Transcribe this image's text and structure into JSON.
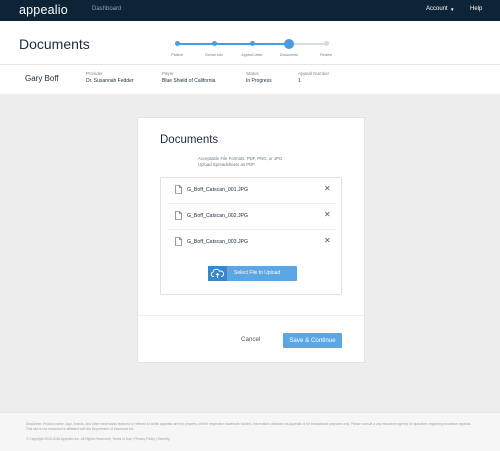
{
  "app": {
    "logo": "appealio",
    "nav_dashboard": "Dashboard",
    "nav_account": "Account",
    "nav_help": "Help"
  },
  "page": {
    "title": "Documents"
  },
  "stepper": {
    "accent": "#4a9be0",
    "inactive": "#d6dbe0",
    "steps": [
      {
        "label": "Patient",
        "state": "complete"
      },
      {
        "label": "Denial Info",
        "state": "complete"
      },
      {
        "label": "Appeal Letter",
        "state": "complete"
      },
      {
        "label": "Documents",
        "state": "active"
      },
      {
        "label": "Review",
        "state": "upcoming"
      }
    ]
  },
  "patient": {
    "name": "Gary Boff",
    "provider_label": "Provider",
    "provider": "Dr. Susannah Fedder",
    "payer_label": "Payer",
    "payer": "Blue Shield of California",
    "status_label": "Status",
    "status": "In Progress",
    "appeal_label": "Appeal Number",
    "appeal_number": "1"
  },
  "card": {
    "title": "Documents",
    "formats_line1": "Acceptable File Formats: PDF, PNG, or JPG",
    "formats_line2": "Upload Spreadsheets as PDF",
    "files": [
      "G_Boff_Catscan_001.JPG",
      "G_Boff_Catscan_002.JPG",
      "G_Boff_Catscan_003.JPG"
    ],
    "upload_label": "Select File to Upload",
    "cancel_label": "Cancel",
    "save_label": "Save & Continue"
  },
  "footer": {
    "disclaimer": "Disclaimer: Product name, logo, brands, and other trademarks featured or referred to within Appealio are the property of their respective trademark holders. Information obtained via Appealio is for educational purposes only. Please consult a any insurance agency for questions regarding insurance appeals. This site is not endorsed or affiliated with the Department of Insurance etc.",
    "copyright": "© Copyright 2015-2016 Appealio Inc. All Rights Reserved | Terms of Use | Privacy Policy | Security"
  }
}
